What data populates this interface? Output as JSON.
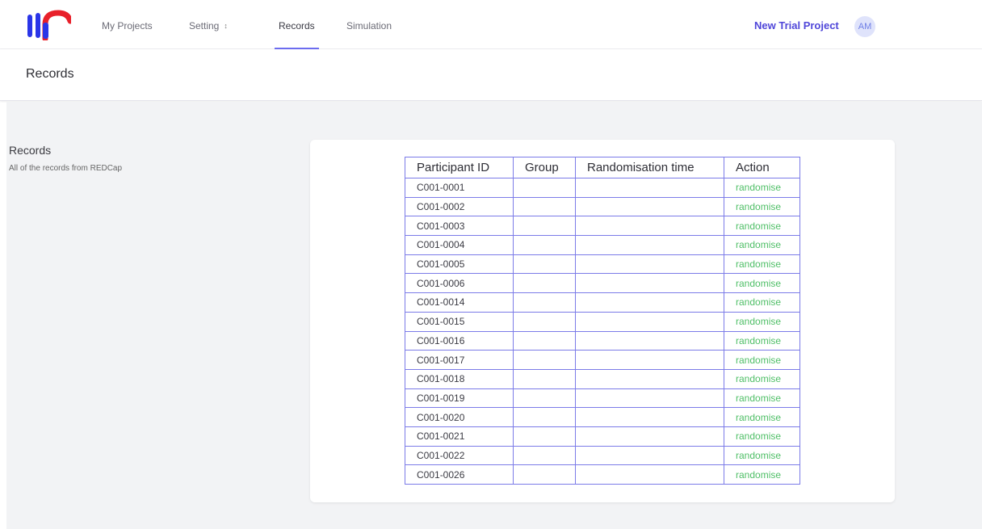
{
  "nav": {
    "items": [
      {
        "label": "My Projects"
      },
      {
        "label": "Setting"
      },
      {
        "label": "Records"
      },
      {
        "label": "Simulation"
      }
    ],
    "project_name": "New Trial Project",
    "avatar_initials": "AM"
  },
  "colors": {
    "brand_blue": "#2a35e8",
    "brand_red": "#e8202a",
    "accent": "#6c6cf0",
    "action_green": "#4fbf67"
  },
  "page": {
    "title": "Records"
  },
  "section": {
    "title": "Records",
    "description": "All of the records from REDCap"
  },
  "table": {
    "headers": [
      "Participant ID",
      "Group",
      "Randomisation time",
      "Action"
    ],
    "rows": [
      {
        "id": "C001-0001",
        "group": "",
        "time": "",
        "action": "randomise"
      },
      {
        "id": "C001-0002",
        "group": "",
        "time": "",
        "action": "randomise"
      },
      {
        "id": "C001-0003",
        "group": "",
        "time": "",
        "action": "randomise"
      },
      {
        "id": "C001-0004",
        "group": "",
        "time": "",
        "action": "randomise"
      },
      {
        "id": "C001-0005",
        "group": "",
        "time": "",
        "action": "randomise"
      },
      {
        "id": "C001-0006",
        "group": "",
        "time": "",
        "action": "randomise"
      },
      {
        "id": "C001-0014",
        "group": "",
        "time": "",
        "action": "randomise"
      },
      {
        "id": "C001-0015",
        "group": "",
        "time": "",
        "action": "randomise"
      },
      {
        "id": "C001-0016",
        "group": "",
        "time": "",
        "action": "randomise"
      },
      {
        "id": "C001-0017",
        "group": "",
        "time": "",
        "action": "randomise"
      },
      {
        "id": "C001-0018",
        "group": "",
        "time": "",
        "action": "randomise"
      },
      {
        "id": "C001-0019",
        "group": "",
        "time": "",
        "action": "randomise"
      },
      {
        "id": "C001-0020",
        "group": "",
        "time": "",
        "action": "randomise"
      },
      {
        "id": "C001-0021",
        "group": "",
        "time": "",
        "action": "randomise"
      },
      {
        "id": "C001-0022",
        "group": "",
        "time": "",
        "action": "randomise"
      },
      {
        "id": "C001-0026",
        "group": "",
        "time": "",
        "action": "randomise"
      }
    ]
  }
}
